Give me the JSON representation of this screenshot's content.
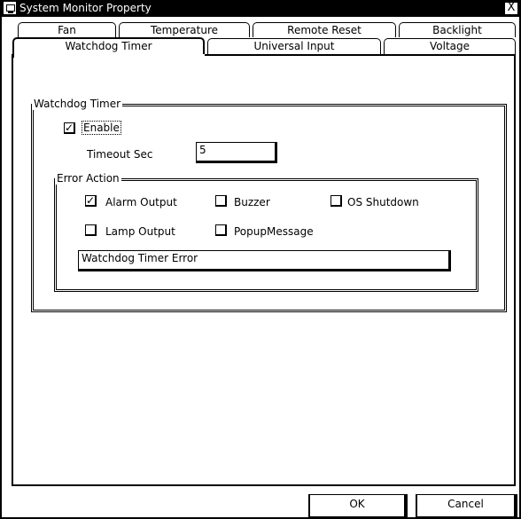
{
  "window": {
    "title": "System Monitor Property",
    "close_label": "X"
  },
  "tabs": {
    "row1": [
      "Fan",
      "Temperature",
      "Remote Reset",
      "Backlight"
    ],
    "row2": [
      "Watchdog Timer",
      "Universal Input",
      "Voltage"
    ],
    "selected": "Watchdog Timer"
  },
  "watchdog": {
    "group_label": "Watchdog Timer",
    "enable_label": "Enable",
    "enable_checked": true,
    "timeout_label": "Timeout Sec",
    "timeout_value": "5"
  },
  "error_action": {
    "group_label": "Error Action",
    "alarm_output_label": "Alarm Output",
    "alarm_output_checked": true,
    "buzzer_label": "Buzzer",
    "buzzer_checked": false,
    "os_shutdown_label": "OS Shutdown",
    "os_shutdown_checked": false,
    "lamp_output_label": "Lamp Output",
    "lamp_output_checked": false,
    "popup_message_label": "PopupMessage",
    "popup_message_checked": false,
    "message_value": "Watchdog Timer Error"
  },
  "buttons": {
    "ok_label": "OK",
    "cancel_label": "Cancel"
  },
  "check_glyph": "✓"
}
